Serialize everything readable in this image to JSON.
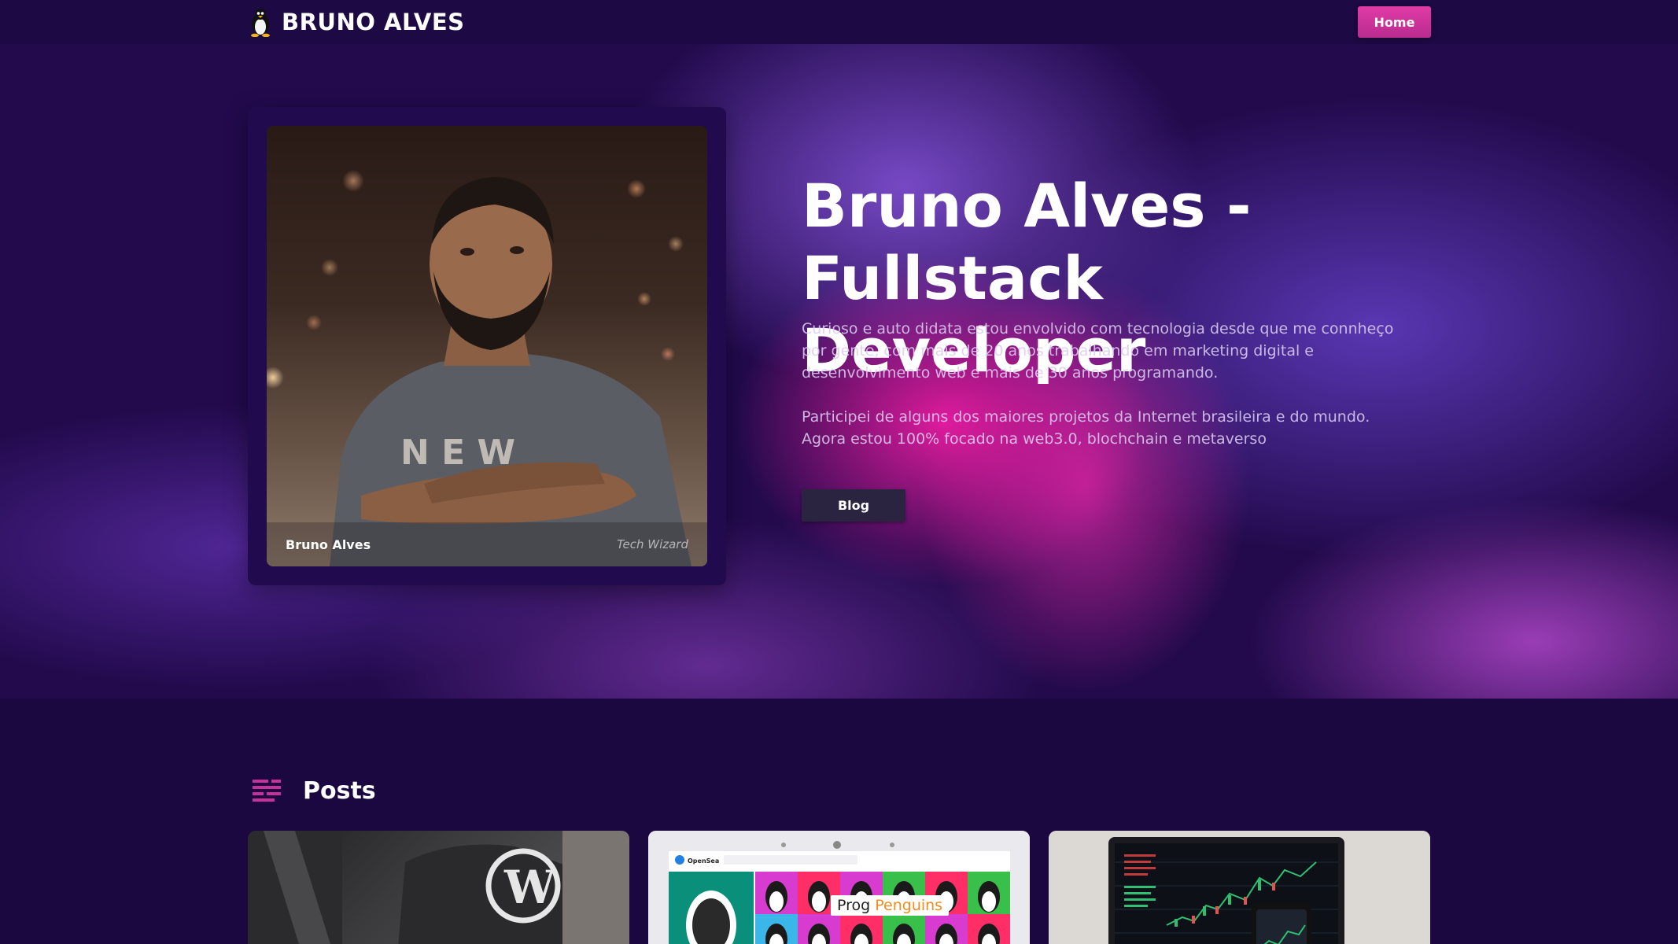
{
  "header": {
    "brand": "BRUNO ALVES",
    "brand_icon": "penguin-icon",
    "nav_home": "Home"
  },
  "hero": {
    "title": "Bruno Alves - Fullstack Developer",
    "paragraph_1": "Curioso e auto didata estou envolvido com tecnologia desde que me connheço por gente, com mais de 20 anos trabalhando em marketing digital e desenvolvimento web e mais de 30 anos programando.",
    "paragraph_2": "Participei de alguns dos maiores projetos da Internet brasileira e do mundo. Agora estou 100% focado na web3.0, blochchain e metaverso",
    "blog_button": "Blog",
    "profile": {
      "name": "Bruno Alves",
      "role": "Tech Wizard"
    }
  },
  "posts": {
    "title": "Posts",
    "icon": "list-lines-icon",
    "cards": [
      {
        "thumbnail": "wordpress-shirt-photo"
      },
      {
        "thumbnail": "opensea-prog-penguins",
        "overlay_text_1": "Prog",
        "overlay_text_2": "Penguins",
        "site_name": "OpenSea"
      },
      {
        "thumbnail": "trading-laptop-photo"
      }
    ]
  },
  "colors": {
    "background": "#1b0840",
    "accent_pink": "#e13ca6",
    "button_dark": "#2b2440"
  }
}
